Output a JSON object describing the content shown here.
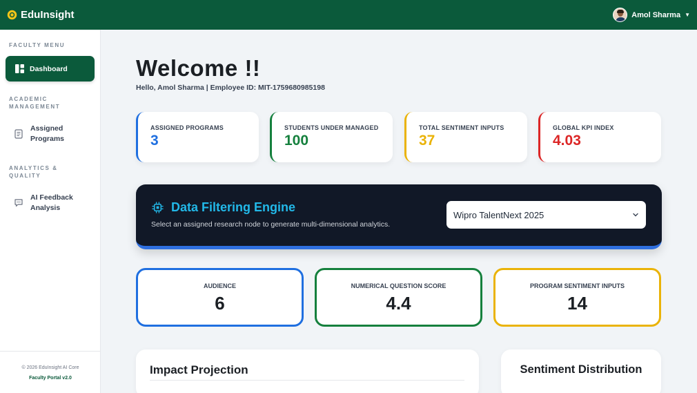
{
  "header": {
    "brand": "EduInsight",
    "user_name": "Amol Sharma"
  },
  "sidebar": {
    "faculty_menu_label": "FACULTY MENU",
    "dashboard_label": "Dashboard",
    "academic_label": "ACADEMIC MANAGEMENT",
    "assigned_programs_label": "Assigned Programs",
    "analytics_label": "ANALYTICS & QUALITY",
    "ai_feedback_label": "AI Feedback Analysis",
    "footer_copy": "© 2026 EduInsight AI Core",
    "footer_version": "Faculty Portal v2.0"
  },
  "main": {
    "welcome": "Welcome !!",
    "hello_line": "Hello, Amol Sharma | Employee ID: MIT-1759680985198",
    "stats": [
      {
        "label": "ASSIGNED PROGRAMS",
        "value": "3",
        "color": "#1f6fe0"
      },
      {
        "label": "STUDENTS UNDER MANAGED",
        "value": "100",
        "color": "#15803d"
      },
      {
        "label": "TOTAL SENTIMENT INPUTS",
        "value": "37",
        "color": "#eab308"
      },
      {
        "label": "GLOBAL KPI INDEX",
        "value": "4.03",
        "color": "#dc2626"
      }
    ],
    "engine": {
      "title": "Data Filtering Engine",
      "subtitle": "Select an assigned research node to generate multi-dimensional analytics.",
      "selected_program": "Wipro TalentNext 2025"
    },
    "metrics": [
      {
        "label": "AUDIENCE",
        "value": "6",
        "color": "#1f6fe0"
      },
      {
        "label": "NUMERICAL QUESTION SCORE",
        "value": "4.4",
        "color": "#15803d"
      },
      {
        "label": "PROGRAM SENTIMENT INPUTS",
        "value": "14",
        "color": "#eab308"
      }
    ],
    "impact_title": "Impact Projection",
    "sentiment_title": "Sentiment Distribution"
  },
  "colors": {
    "brand_green": "#0b5a3b",
    "engine_bg": "#111827",
    "engine_accent": "#22b8e8"
  }
}
